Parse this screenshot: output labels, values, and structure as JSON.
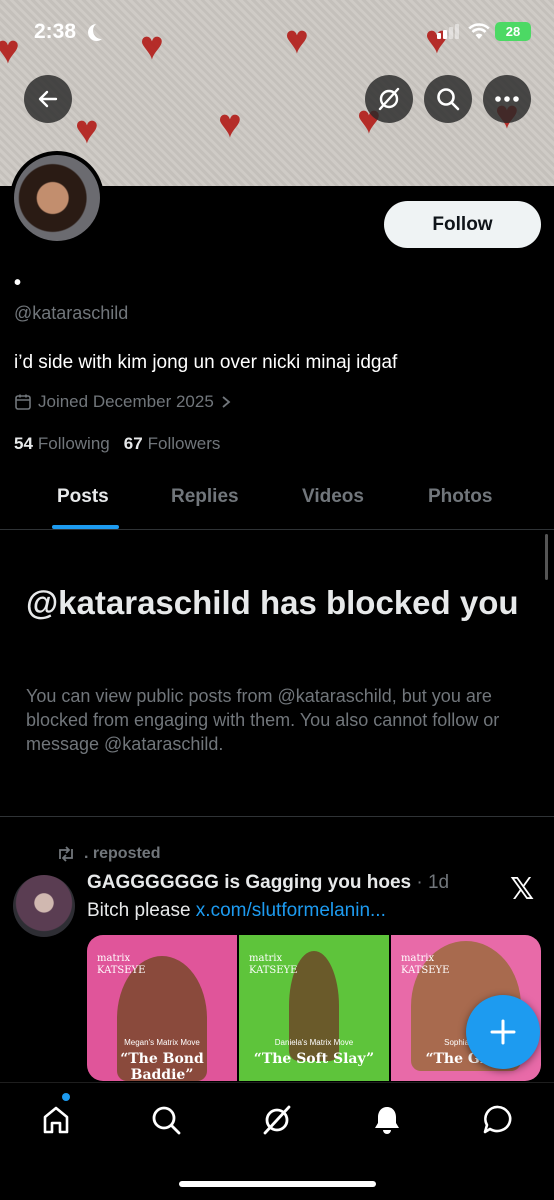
{
  "status_bar": {
    "time": "2:38",
    "battery": "28"
  },
  "header": {
    "back_icon": "arrow-left-icon",
    "grok_icon": "slash-circle-icon",
    "search_icon": "search-icon",
    "more_icon": "more-icon"
  },
  "profile": {
    "display_name": "•",
    "handle": "@kataraschild",
    "bio": "i’d side with kim jong un over nicki minaj idgaf",
    "joined": "Joined December 2025",
    "following_count": "54",
    "following_label": "Following",
    "followers_count": "67",
    "followers_label": "Followers",
    "follow_label": "Follow"
  },
  "tabs": [
    {
      "label": "Posts",
      "active": true
    },
    {
      "label": "Replies",
      "active": false
    },
    {
      "label": "Videos",
      "active": false
    },
    {
      "label": "Photos",
      "active": false
    }
  ],
  "blocked": {
    "title": "@kataraschild has blocked you",
    "description": "You can view public posts from @kataraschild, but you are blocked from engaging with them. You also cannot follow or message @kataraschild."
  },
  "post": {
    "repost_label": ". reposted",
    "author": "GAGGGGGGG is Gagging you hoes",
    "time": "· 1d",
    "text": "Bitch please ",
    "link": "x.com/slutformelanin...",
    "media": [
      {
        "brand": "matrix",
        "brand2": "KATSEYE",
        "move": "Megan's Matrix Move",
        "tag": "“The Bond Baddie”",
        "bg": "#e0559a"
      },
      {
        "brand": "matrix",
        "brand2": "KATSEYE",
        "move": "Daniela's Matrix Move",
        "tag": "“The Soft Slay”",
        "bg": "#5ec43b"
      },
      {
        "brand": "matrix",
        "brand2": "KATSEYE",
        "move": "Sophia's Ma",
        "tag": "“The Glow",
        "bg": "#e86aa8"
      }
    ]
  },
  "colors": {
    "accent": "#1d9bf0",
    "background": "#000000",
    "muted": "#71767b"
  },
  "nav": [
    "home-icon",
    "search-icon",
    "grok-icon",
    "notifications-icon",
    "messages-icon"
  ]
}
